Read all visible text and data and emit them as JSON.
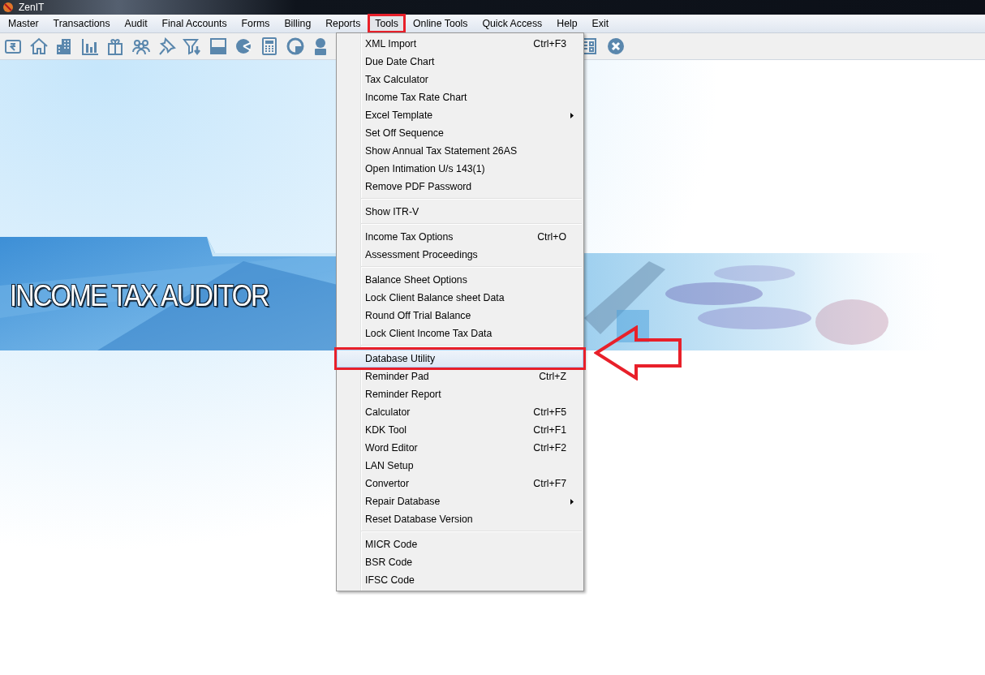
{
  "window": {
    "title": "ZenIT"
  },
  "menubar": [
    {
      "label": "Master",
      "selected": false,
      "annotated": false
    },
    {
      "label": "Transactions",
      "selected": false,
      "annotated": false
    },
    {
      "label": "Audit",
      "selected": false,
      "annotated": false
    },
    {
      "label": "Final Accounts",
      "selected": false,
      "annotated": false
    },
    {
      "label": "Forms",
      "selected": false,
      "annotated": false
    },
    {
      "label": "Billing",
      "selected": false,
      "annotated": false
    },
    {
      "label": "Reports",
      "selected": false,
      "annotated": false
    },
    {
      "label": "Tools",
      "selected": true,
      "annotated": true
    },
    {
      "label": "Online Tools",
      "selected": false,
      "annotated": false
    },
    {
      "label": "Quick Access",
      "selected": false,
      "annotated": false
    },
    {
      "label": "Help",
      "selected": false,
      "annotated": false
    },
    {
      "label": "Exit",
      "selected": false,
      "annotated": false
    }
  ],
  "banner": {
    "title": "INCOME TAX AUDITOR"
  },
  "tools_menu": {
    "groups": [
      [
        {
          "label": "XML Import",
          "shortcut": "Ctrl+F3",
          "kind": "item",
          "selected": false,
          "annotated": false
        },
        {
          "label": "Due Date Chart",
          "kind": "item",
          "selected": false,
          "annotated": false
        },
        {
          "label": "Tax Calculator",
          "kind": "item",
          "selected": false,
          "annotated": false
        },
        {
          "label": "Income Tax Rate Chart",
          "kind": "item",
          "selected": false,
          "annotated": false
        },
        {
          "label": "Excel Template",
          "kind": "submenu",
          "selected": false,
          "annotated": false
        },
        {
          "label": "Set Off Sequence",
          "kind": "item",
          "selected": false,
          "annotated": false
        },
        {
          "label": "Show Annual Tax Statement 26AS",
          "kind": "item",
          "selected": false,
          "annotated": false
        },
        {
          "label": "Open Intimation U/s 143(1)",
          "kind": "item",
          "selected": false,
          "annotated": false
        },
        {
          "label": "Remove PDF Password",
          "kind": "item",
          "selected": false,
          "annotated": false
        }
      ],
      [
        {
          "label": "Show ITR-V",
          "kind": "item",
          "selected": false,
          "annotated": false
        }
      ],
      [
        {
          "label": "Income Tax Options",
          "shortcut": "Ctrl+O",
          "kind": "item",
          "selected": false,
          "annotated": false
        },
        {
          "label": "Assessment Proceedings",
          "kind": "item",
          "selected": false,
          "annotated": false
        }
      ],
      [
        {
          "label": "Balance Sheet Options",
          "kind": "item",
          "selected": false,
          "annotated": false
        },
        {
          "label": "Lock Client Balance sheet Data",
          "kind": "item",
          "selected": false,
          "annotated": false
        },
        {
          "label": "Round Off Trial Balance",
          "kind": "item",
          "selected": false,
          "annotated": false
        },
        {
          "label": "Lock Client Income Tax Data",
          "kind": "item",
          "selected": false,
          "annotated": false
        }
      ],
      [
        {
          "label": "Database Utility",
          "kind": "item",
          "selected": true,
          "annotated": true
        },
        {
          "label": "Reminder Pad",
          "shortcut": "Ctrl+Z",
          "kind": "item",
          "selected": false,
          "annotated": false
        },
        {
          "label": "Reminder Report",
          "kind": "item",
          "selected": false,
          "annotated": false
        },
        {
          "label": "Calculator",
          "shortcut": "Ctrl+F5",
          "kind": "item",
          "selected": false,
          "annotated": false
        },
        {
          "label": "KDK Tool",
          "shortcut": "Ctrl+F1",
          "kind": "item",
          "selected": false,
          "annotated": false
        },
        {
          "label": "Word Editor",
          "shortcut": "Ctrl+F2",
          "kind": "item",
          "selected": false,
          "annotated": false
        },
        {
          "label": "LAN Setup",
          "kind": "item",
          "selected": false,
          "annotated": false
        },
        {
          "label": "Convertor",
          "shortcut": "Ctrl+F7",
          "kind": "item",
          "selected": false,
          "annotated": false
        },
        {
          "label": "Repair Database",
          "kind": "submenu",
          "selected": false,
          "annotated": false
        },
        {
          "label": "Reset Database Version",
          "kind": "item",
          "selected": false,
          "annotated": false
        }
      ],
      [
        {
          "label": "MICR Code",
          "kind": "item",
          "selected": false,
          "annotated": false
        },
        {
          "label": "BSR Code",
          "kind": "item",
          "selected": false,
          "annotated": false
        },
        {
          "label": "IFSC Code",
          "kind": "item",
          "selected": false,
          "annotated": false
        }
      ]
    ]
  }
}
